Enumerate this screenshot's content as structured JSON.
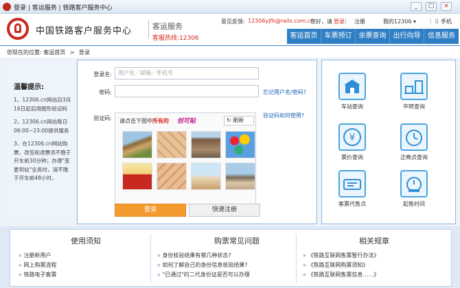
{
  "window": {
    "title": "登录 | 客运服务 | 铁路客户服务中心",
    "min": "_",
    "max": "□",
    "close": "×"
  },
  "header": {
    "company": "中国铁路客户服务中心",
    "service": "客运服务",
    "hotline": "客服热线:12306",
    "feedback_label": "意见反馈:",
    "feedback_email": "12306yjfk@rails.com.cn",
    "greeting": "您好，请",
    "login_link": "登录",
    "register_link": "注册",
    "my12306": "我的12306 ▾",
    "mobile": "手机"
  },
  "nav": [
    "客运首页",
    "车票预订",
    "余票查询",
    "出行向导",
    "信息服务"
  ],
  "breadcrumb": {
    "prefix": "您现在的位置:",
    "home": "客运首页",
    "sep": ">",
    "current": "登录"
  },
  "tips": {
    "heading": "温馨提示:",
    "items": [
      "1、12306.cn网站自3月16日起启用图形验证码",
      "2、12306.cn网站每日06:00~23:00提供服务",
      "3、在12306.cn网站购票、改签和退票须不晚于开车前30分钟；办理\"变更到站\"业务时，请不晚于开车前48小时。"
    ]
  },
  "login": {
    "username_label": "登录名:",
    "username_placeholder": "用户名／邮箱／手机号",
    "password_label": "密码:",
    "forgot": "忘记用户名/密码?",
    "captcha_label": "验证码:",
    "captcha_help": "验证码如何使用?",
    "captcha_prompt_a": "请点击下图中",
    "captcha_prompt_b": "所有的",
    "captcha_word": "创可贴",
    "refresh": "刷新",
    "login_button": "登录",
    "register_button": "快速注册"
  },
  "captcha_images": [
    "horse",
    "bandage",
    "church",
    "balloons",
    "popcorn",
    "bandage-2",
    "shoes",
    "camels"
  ],
  "services": [
    {
      "label": "车站查询",
      "icon": "station-icon"
    },
    {
      "label": "中转查询",
      "icon": "transfer-icon"
    },
    {
      "label": "票价查询",
      "icon": "yen-icon"
    },
    {
      "label": "正晚点查询",
      "icon": "clock-icon"
    },
    {
      "label": "客票代售点",
      "icon": "ticket-icon"
    },
    {
      "label": "起售时间",
      "icon": "alarm-icon"
    }
  ],
  "bottom": {
    "col1": {
      "heading": "使用须知",
      "items": [
        "注册新用户",
        "网上购票流程",
        "铁路电子客票"
      ]
    },
    "col2": {
      "heading": "购票常见问题",
      "items": [
        "身份核验结果有哪几种状态?",
        "如何了解自己的身份信息核验结果?",
        "\"已通过\"的二代身份证是否可以办理"
      ]
    },
    "col3": {
      "heading": "相关规章",
      "items": [
        "《铁路互联网售票暂行办法》",
        "《铁路互联网购票须知》",
        "《铁路互联网售票信息……》"
      ]
    }
  },
  "colors": {
    "brand_red": "#c8281f",
    "nav_blue": "#2f7fc4",
    "button_orange": "#f49b30"
  }
}
